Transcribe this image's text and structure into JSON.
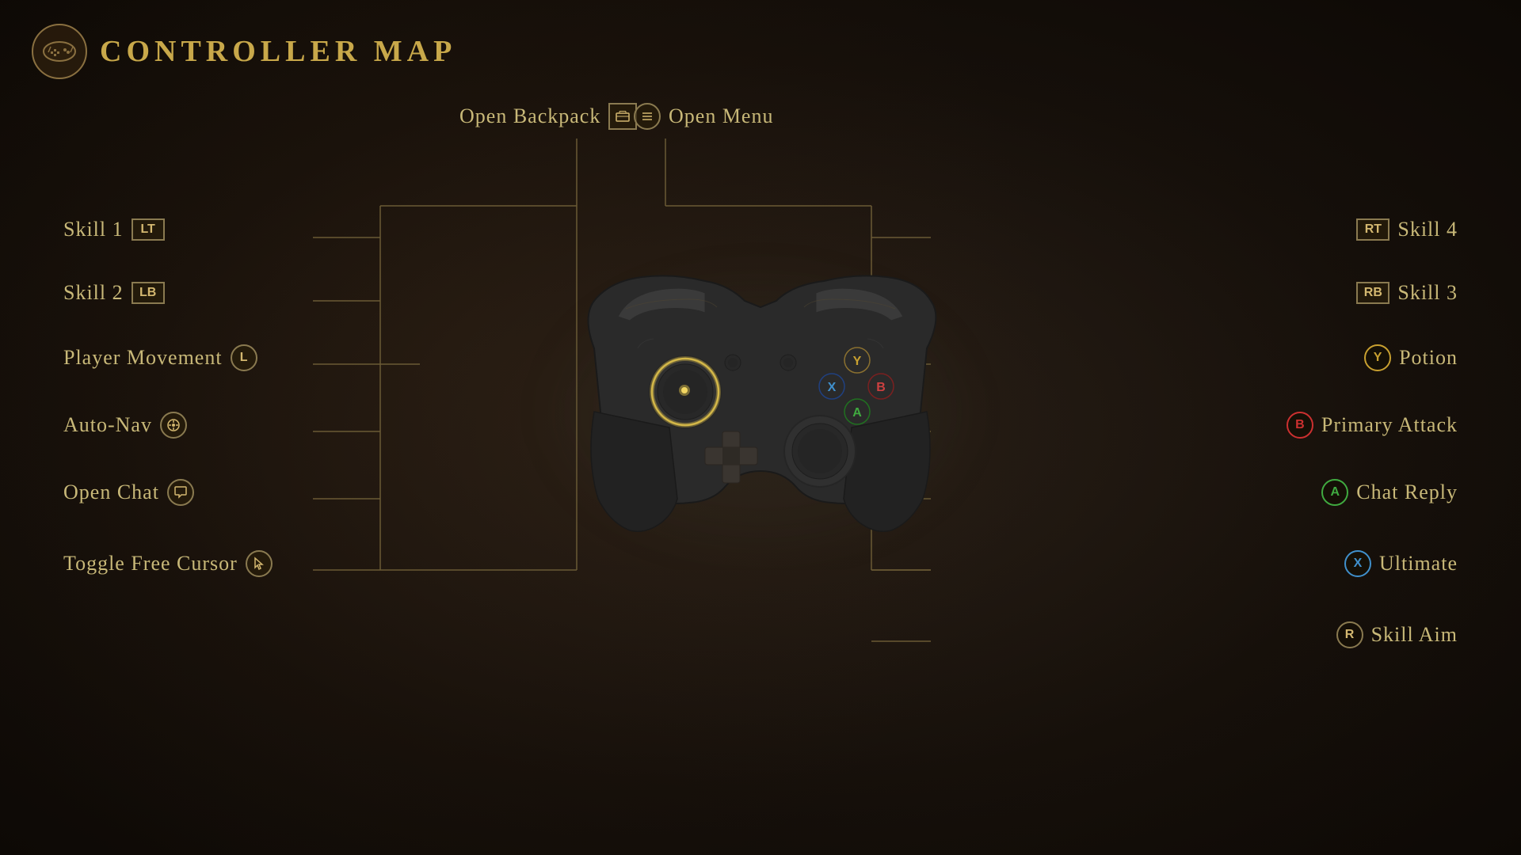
{
  "title": {
    "label": "CONTROLLER MAP",
    "icon": "🎮"
  },
  "top_labels": [
    {
      "text": "Open Backpack",
      "badge": "☰",
      "badge_type": "square",
      "id": "open-backpack"
    },
    {
      "text": "Open Menu",
      "badge": "☰",
      "badge_type": "circle",
      "id": "open-menu"
    }
  ],
  "left_labels": [
    {
      "text": "Skill 1",
      "badge": "LT",
      "badge_type": "rect",
      "id": "skill1"
    },
    {
      "text": "Skill 2",
      "badge": "LB",
      "badge_type": "rect",
      "id": "skill2"
    },
    {
      "text": "Player Movement",
      "badge": "L",
      "badge_type": "circle",
      "id": "player-movement"
    },
    {
      "text": "Auto-Nav",
      "badge": "🎮",
      "badge_type": "icon",
      "id": "auto-nav"
    },
    {
      "text": "Open Chat",
      "badge": "🎮",
      "badge_type": "icon",
      "id": "open-chat"
    },
    {
      "text": "Toggle Free Cursor",
      "badge": "🎮",
      "badge_type": "icon",
      "id": "toggle-free-cursor"
    }
  ],
  "right_labels": [
    {
      "text": "Skill 4",
      "badge": "RT",
      "badge_type": "rect",
      "color": "plain",
      "id": "skill4"
    },
    {
      "text": "Skill 3",
      "badge": "RB",
      "badge_type": "rect",
      "color": "plain",
      "id": "skill3"
    },
    {
      "text": "Potion",
      "badge": "Y",
      "badge_type": "circle",
      "color": "yellow",
      "id": "potion"
    },
    {
      "text": "Primary Attack",
      "badge": "B",
      "badge_type": "circle",
      "color": "red",
      "id": "primary-attack"
    },
    {
      "text": "Chat Reply",
      "badge": "A",
      "badge_type": "circle",
      "color": "green",
      "id": "chat-reply"
    },
    {
      "text": "Ultimate",
      "badge": "X",
      "badge_type": "circle",
      "color": "blue",
      "id": "ultimate"
    },
    {
      "text": "Skill Aim",
      "badge": "R",
      "badge_type": "circle",
      "color": "plain",
      "id": "skill-aim"
    }
  ],
  "colors": {
    "gold": "#c8a84a",
    "text": "#c8b878",
    "line": "#6a5a35",
    "badge_border": "#8a7a50",
    "badge_text": "#d4b870",
    "yellow_btn": "#c8a030",
    "red_btn": "#cc3030",
    "green_btn": "#40aa40",
    "blue_btn": "#4090cc"
  }
}
